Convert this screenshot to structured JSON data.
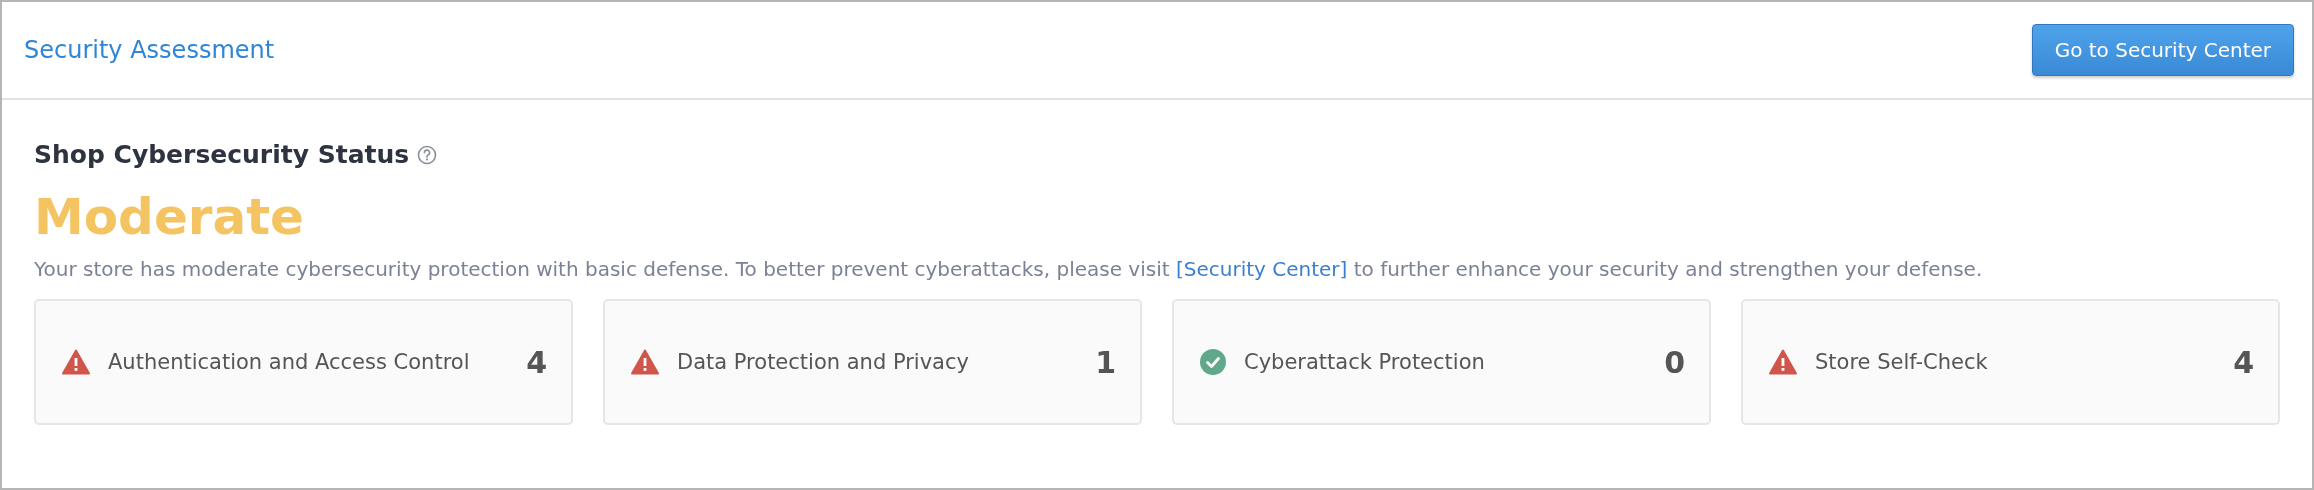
{
  "header": {
    "title": "Security Assessment",
    "button": "Go to Security Center"
  },
  "status": {
    "heading": "Shop Cybersecurity Status",
    "level": "Moderate",
    "description_before": "Your store has moderate cybersecurity protection with basic defense. To better prevent cyberattacks, please visit ",
    "link": "[Security Center]",
    "description_after": " to further enhance your security and strengthen your defense."
  },
  "categories": [
    {
      "kind": "warning",
      "label": "Authentication and Access Control",
      "count": "4"
    },
    {
      "kind": "warning",
      "label": "Data Protection and Privacy",
      "count": "1"
    },
    {
      "kind": "ok",
      "label": "Cyberattack Protection",
      "count": "0"
    },
    {
      "kind": "warning",
      "label": "Store Self-Check",
      "count": "4"
    }
  ]
}
